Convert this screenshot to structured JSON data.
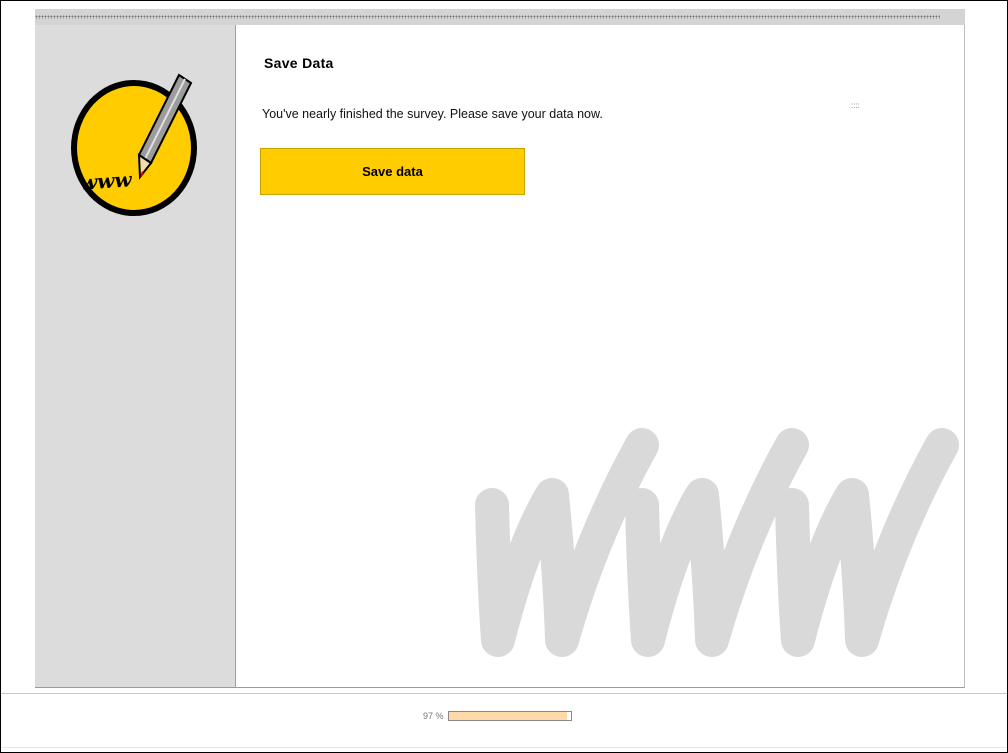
{
  "page": {
    "title": "Save Data",
    "message": "You've nearly finished the survey. Please save your data now.",
    "decorative_dots": "::::"
  },
  "actions": {
    "save_label": "Save data"
  },
  "logo": {
    "text": "www",
    "icon": "pencil-icon"
  },
  "progress": {
    "label": "97 %",
    "value": 0.97
  },
  "colors": {
    "accent": "#ffcc00",
    "sidebar": "#dcdcdc",
    "progress_fill": "#ffd9a8",
    "watermark": "#d9d9d9"
  }
}
